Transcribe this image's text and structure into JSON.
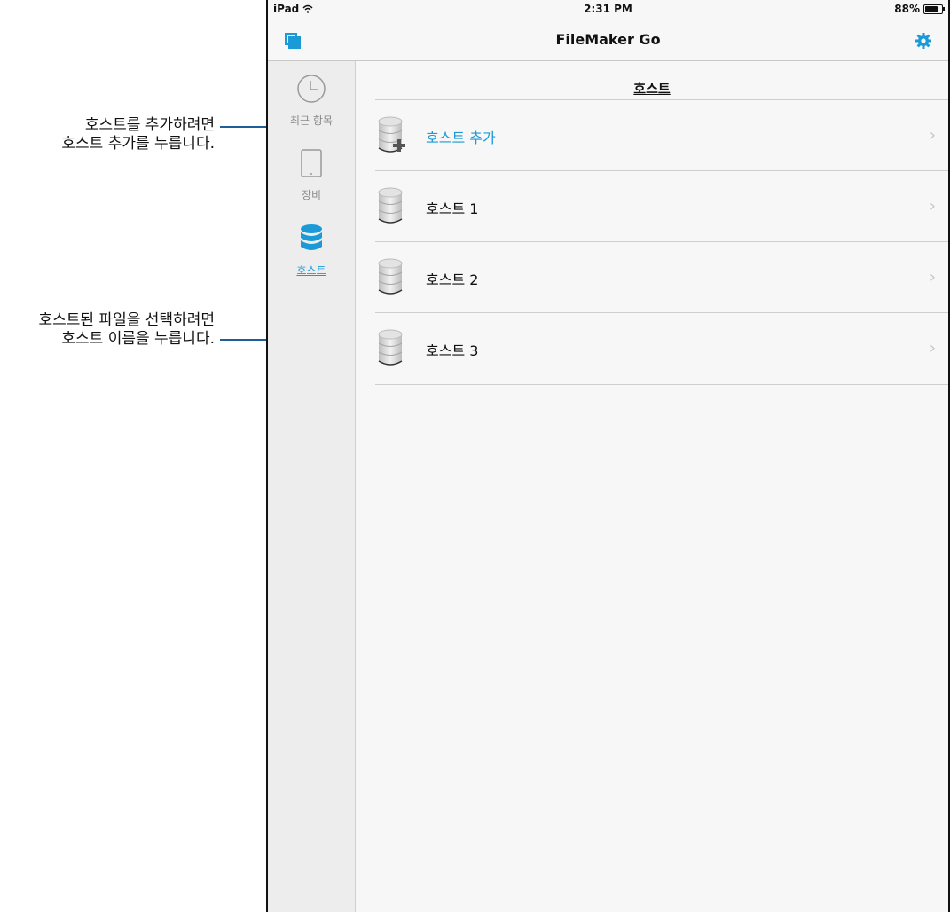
{
  "callouts": [
    {
      "line1": "호스트를 추가하려면",
      "line2": "호스트 추가를 누릅니다."
    },
    {
      "line1": "호스트된 파일을 선택하려면",
      "line2": "호스트 이름을 누릅니다."
    }
  ],
  "status_bar": {
    "device": "iPad",
    "time": "2:31 PM",
    "battery": "88%",
    "battery_level": 0.88
  },
  "nav": {
    "title": "FileMaker Go",
    "left_icon": "copy-windows-icon",
    "right_icon": "gear-icon"
  },
  "sidebar": {
    "items": [
      {
        "label": "최근 항목",
        "icon": "clock-icon",
        "active": false
      },
      {
        "label": "장비",
        "icon": "tablet-icon",
        "active": false
      },
      {
        "label": "호스트",
        "icon": "database-icon",
        "active": true
      }
    ]
  },
  "main": {
    "title": "호스트",
    "rows": [
      {
        "label": "호스트 추가",
        "icon": "database-add-icon"
      },
      {
        "label": "호스트 1",
        "icon": "database-icon"
      },
      {
        "label": "호스트 2",
        "icon": "database-icon"
      },
      {
        "label": "호스트 3",
        "icon": "database-icon"
      }
    ]
  },
  "colors": {
    "accent": "#1a9ad6",
    "callout_line": "#1f5f99"
  }
}
